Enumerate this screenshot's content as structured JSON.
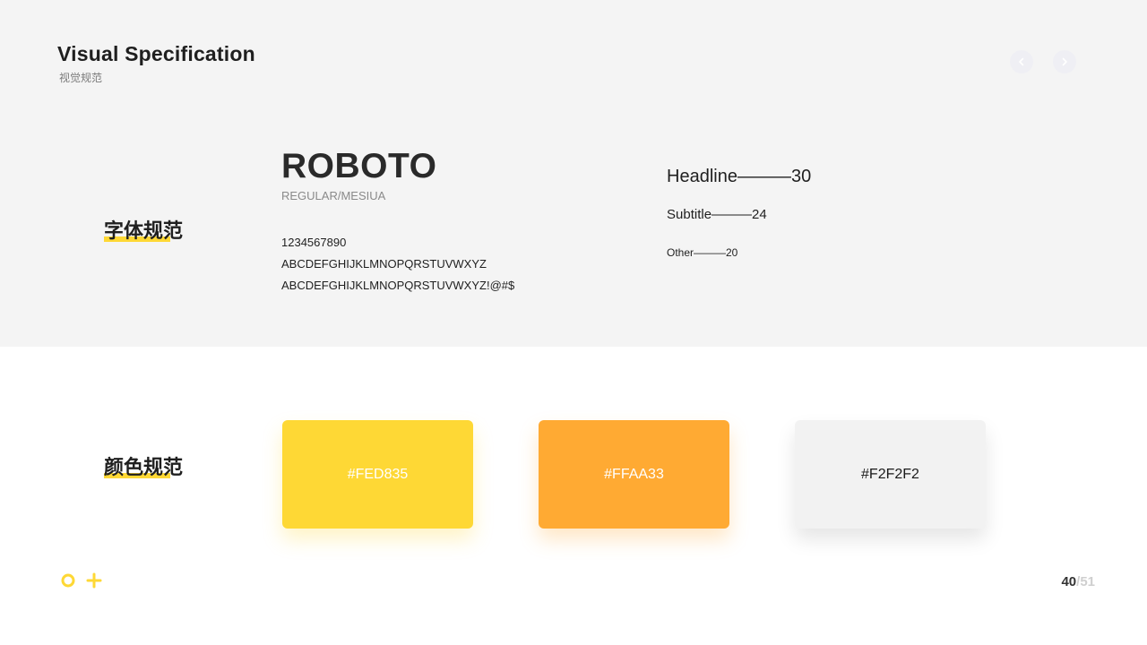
{
  "header": {
    "title": "Visual Specification",
    "subtitle": "视觉规范"
  },
  "nav": {
    "prev_icon": "chevron-left-icon",
    "next_icon": "chevron-right-icon"
  },
  "typography": {
    "section_label": "字体规范",
    "font_name": "ROBOTO",
    "font_weights": "REGULAR/MESIUA",
    "samples": [
      "1234567890",
      "ABCDEFGHIJKLMNOPQRSTUVWXYZ",
      "ABCDEFGHIJKLMNOPQRSTUVWXYZ!@#$"
    ],
    "sizes": {
      "headline": "Headline———30",
      "subtitle": "Subtitle———24",
      "other": "Other———20"
    }
  },
  "colors": {
    "section_label": "颜色规范",
    "accent": "#fed835",
    "swatches": [
      {
        "hex": "#FED835",
        "color": "#fed835"
      },
      {
        "hex": "#FFAA33",
        "color": "#ffaa33"
      },
      {
        "hex": "#F2F2F2",
        "color": "#f2f2f2"
      }
    ]
  },
  "footer": {
    "deco_icons": [
      "circle-icon",
      "plus-icon"
    ],
    "page_current": "40",
    "page_separator": "/",
    "page_total": "51"
  }
}
